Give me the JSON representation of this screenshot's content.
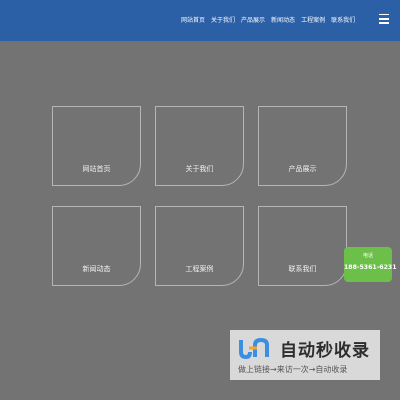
{
  "nav": {
    "items": [
      "网站首页",
      "关于我们",
      "产品展示",
      "新闻动态",
      "工程案例",
      "联系我们"
    ]
  },
  "cards": [
    {
      "label": "网站首页"
    },
    {
      "label": "关于我们"
    },
    {
      "label": "产品展示"
    },
    {
      "label": "新闻动态"
    },
    {
      "label": "工程案例"
    },
    {
      "label": "联系我们"
    }
  ],
  "contact": {
    "title": "电话",
    "phone": "188-5361-6231"
  },
  "watermark": {
    "title": "自动秒收录",
    "subtitle": "做上链接→来访一次→自动收录",
    "logo_icon": "jn-logo-icon"
  },
  "colors": {
    "header": "#2b5fa6",
    "background": "#737373",
    "contact": "#6cc04a",
    "logo_blue": "#3b8fe0",
    "logo_orange": "#f5a623"
  }
}
